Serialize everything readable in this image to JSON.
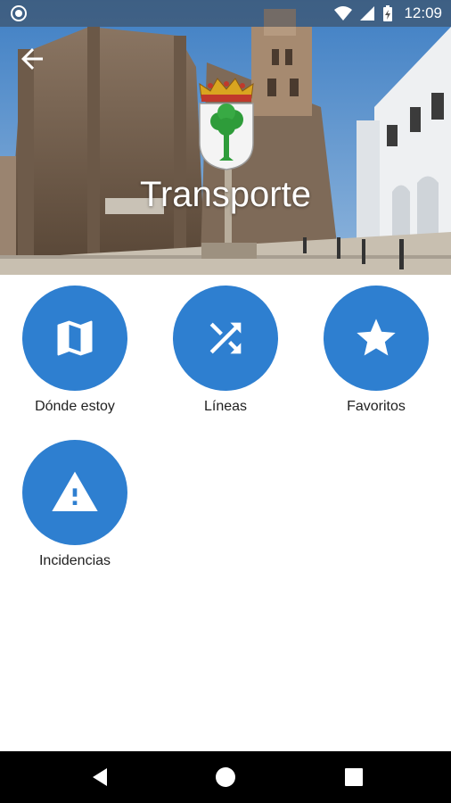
{
  "status_bar": {
    "time": "12:09"
  },
  "header": {
    "title": "Transporte"
  },
  "tiles": [
    {
      "label": "Dónde estoy",
      "icon": "map-icon"
    },
    {
      "label": "Líneas",
      "icon": "shuffle-icon"
    },
    {
      "label": "Favoritos",
      "icon": "star-icon"
    },
    {
      "label": "Incidencias",
      "icon": "warning-icon"
    }
  ],
  "colors": {
    "accent": "#2e7fd0",
    "nav_bar": "#000000",
    "text": "#212121"
  }
}
